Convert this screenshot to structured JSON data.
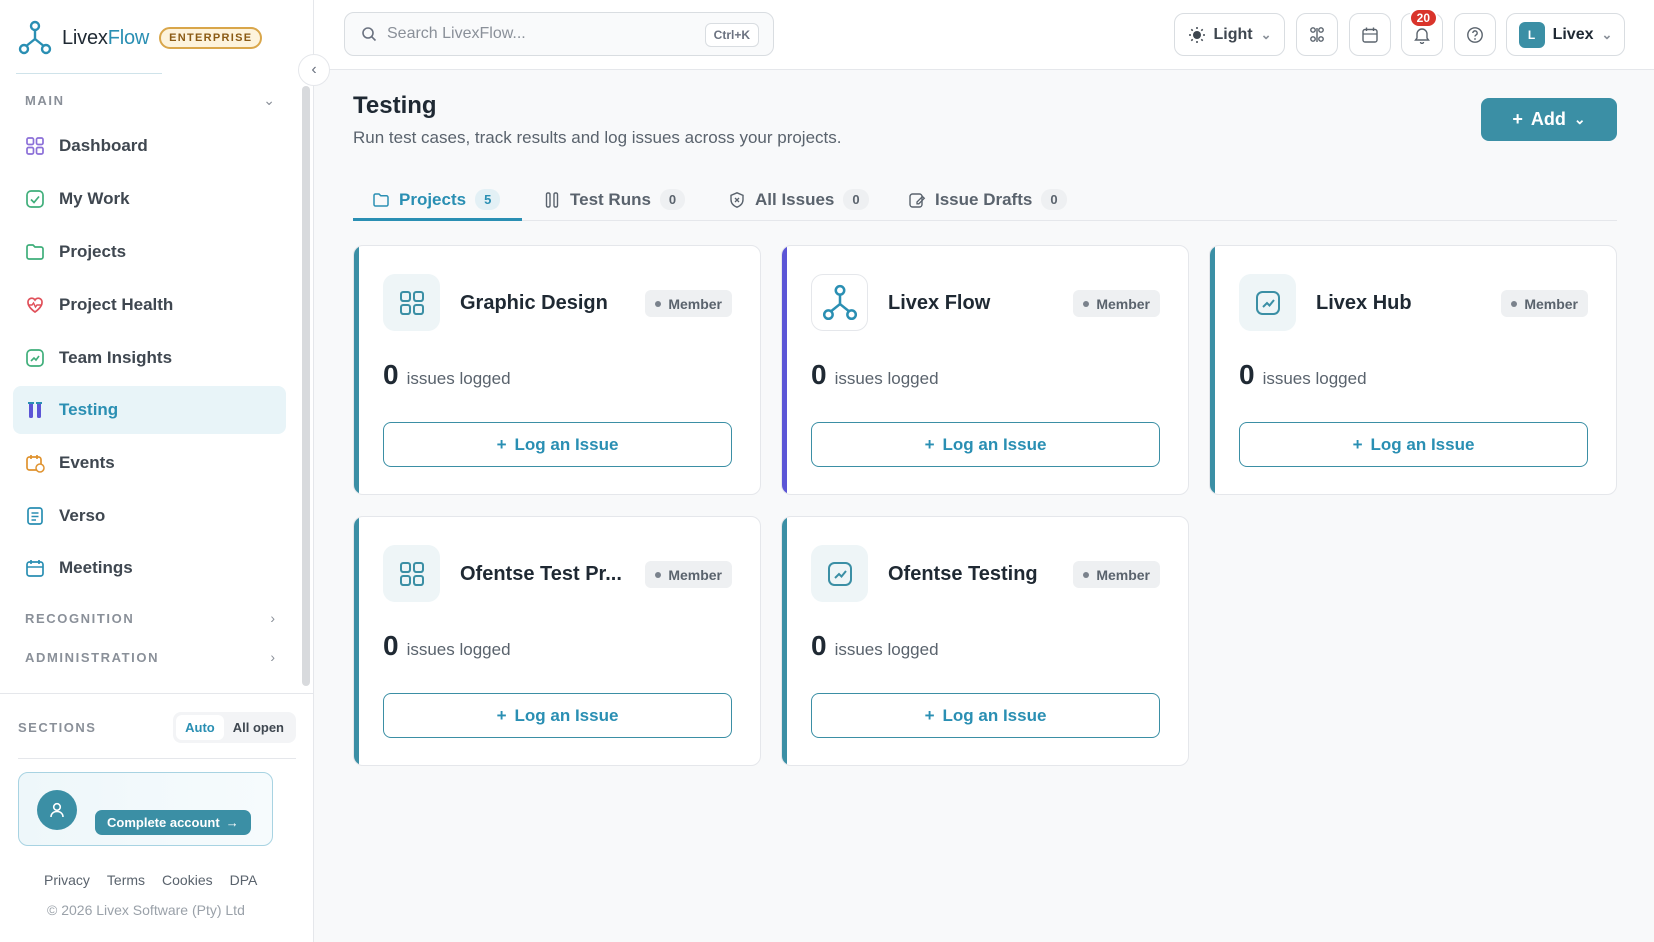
{
  "brand": {
    "name_plain": "Livex",
    "name_accent": "Flow",
    "badge": "ENTERPRISE"
  },
  "sidebar": {
    "main_label": "MAIN",
    "items": [
      {
        "label": "Dashboard",
        "icon": "grid-icon"
      },
      {
        "label": "My Work",
        "icon": "check-square-icon"
      },
      {
        "label": "Projects",
        "icon": "folder-icon"
      },
      {
        "label": "Project Health",
        "icon": "heart-pulse-icon"
      },
      {
        "label": "Team Insights",
        "icon": "trend-icon"
      },
      {
        "label": "Testing",
        "icon": "test-tubes-icon",
        "active": true
      },
      {
        "label": "Events",
        "icon": "calendar-clock-icon"
      },
      {
        "label": "Verso",
        "icon": "notebook-icon"
      },
      {
        "label": "Meetings",
        "icon": "calendar-icon"
      }
    ],
    "recognition_label": "RECOGNITION",
    "administration_label": "ADMINISTRATION",
    "sections_label": "SECTIONS",
    "sections_auto": "Auto",
    "sections_all_open": "All open",
    "complete_account": "Complete account",
    "footer_links": [
      "Privacy",
      "Terms",
      "Cookies",
      "DPA"
    ],
    "copyright": "© 2026 Livex Software (Pty) Ltd"
  },
  "topbar": {
    "search_placeholder": "Search LivexFlow...",
    "search_shortcut": "Ctrl+K",
    "theme_label": "Light",
    "notification_count": "20",
    "user_initial": "L",
    "user_name": "Livex"
  },
  "page": {
    "title": "Testing",
    "subtitle": "Run test cases, track results and log issues across your projects.",
    "add_label": "Add"
  },
  "tabs": [
    {
      "label": "Projects",
      "count": "5",
      "active": true
    },
    {
      "label": "Test Runs",
      "count": "0"
    },
    {
      "label": "All Issues",
      "count": "0"
    },
    {
      "label": "Issue Drafts",
      "count": "0"
    }
  ],
  "projects": [
    {
      "name": "Graphic Design",
      "role": "Member",
      "issues": "0",
      "issues_label": "issues logged",
      "action": "Log an Issue",
      "icon": "grid-icon",
      "stripe": "#3b8fa5"
    },
    {
      "name": "Livex Flow",
      "role": "Member",
      "issues": "0",
      "issues_label": "issues logged",
      "action": "Log an Issue",
      "icon": "livexflow-logo-icon",
      "stripe": "#5b55d6"
    },
    {
      "name": "Livex Hub",
      "role": "Member",
      "issues": "0",
      "issues_label": "issues logged",
      "action": "Log an Issue",
      "icon": "trend-icon",
      "stripe": "#3b8fa5"
    },
    {
      "name": "Ofentse Test Pr...",
      "role": "Member",
      "issues": "0",
      "issues_label": "issues logged",
      "action": "Log an Issue",
      "icon": "grid-icon",
      "stripe": "#3b8fa5"
    },
    {
      "name": "Ofentse Testing",
      "role": "Member",
      "issues": "0",
      "issues_label": "issues logged",
      "action": "Log an Issue",
      "icon": "trend-icon",
      "stripe": "#3b8fa5"
    }
  ],
  "colors": {
    "accent": "#2a8fb3",
    "primary_button": "#3b8fa5",
    "notification": "#d9342b"
  }
}
